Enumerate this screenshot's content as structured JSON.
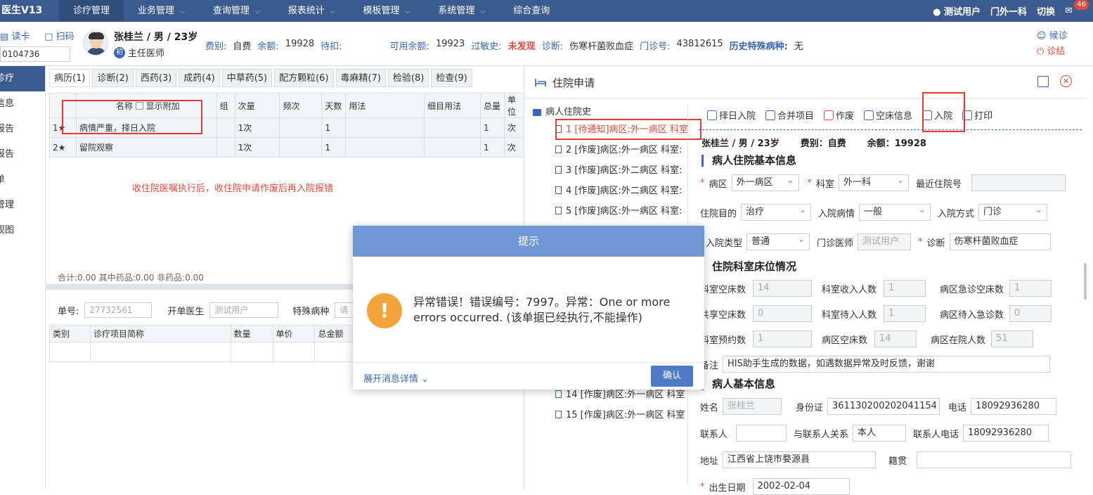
{
  "app": {
    "brand": "医生V13"
  },
  "nav": [
    {
      "label": "诊疗管理",
      "active": true,
      "chev": false
    },
    {
      "label": "业务管理",
      "chev": true
    },
    {
      "label": "查询管理",
      "chev": true
    },
    {
      "label": "报表统计",
      "chev": true
    },
    {
      "label": "模板管理",
      "chev": true
    },
    {
      "label": "系统管理",
      "chev": true
    },
    {
      "label": "综合查询",
      "chev": false
    }
  ],
  "top_right": {
    "user": "测试用户",
    "dept": "门外一科",
    "switch": "切换",
    "mail_count": "46"
  },
  "patient": {
    "read_card": "读卡",
    "scan": "扫码",
    "id_value": "0104736",
    "name": "张桂兰 / 男 / 23岁",
    "chip": "初",
    "doctor_title": "主任医师",
    "fee_type_label": "费别:",
    "fee_type": "自费",
    "balance_label": "余额:",
    "balance": "19928",
    "pending_label": "待扣:",
    "available_label": "可用余额:",
    "available": "19923",
    "allergy_label": "过敏史:",
    "allergy": "未发现",
    "diagnosis_label": "诊断:",
    "diagnosis": "伤寒杆菌败血症",
    "clinic_no_label": "门诊号:",
    "clinic_no": "43812615",
    "special_label": "历史特殊病种:",
    "special": "无",
    "wait_btn": "候诊",
    "finish_btn": "诊结"
  },
  "sidebar": [
    "诊疗",
    "信息",
    "报告",
    "报告",
    "单",
    "管理",
    "视图"
  ],
  "tabs": [
    "病历(1)",
    "诊断(2)",
    "西药(3)",
    "成药(4)",
    "中草药(5)",
    "配方颗粒(6)",
    "毒麻精(7)",
    "检验(8)",
    "检查(9)"
  ],
  "order_table": {
    "headers": [
      "",
      "名称",
      "显示附加",
      "组",
      "次量",
      "频次",
      "天数",
      "用法",
      "细目用法",
      "总量",
      "单位"
    ],
    "rows": [
      {
        "no": "1★",
        "name": "病情严重，择日入院",
        "dose": "1次",
        "days": "1",
        "total": "1",
        "unit": "次"
      },
      {
        "no": "2★",
        "name": "留院观察",
        "dose": "1次",
        "days": "1",
        "total": "1",
        "unit": "次"
      }
    ]
  },
  "note": "收住院医嘱执行后，收住院申请作废后再入院报错",
  "summary": "合计:0.00   其中药品:0.00   非药品:0.00",
  "bill": {
    "no_label": "单号:",
    "no": "27732561",
    "doctor_label": "开单医生",
    "doctor": "测试用户",
    "disease_label": "特殊病种",
    "disease_placeholder": "请"
  },
  "item_table": {
    "headers": [
      "类别",
      "诊疗项目简称",
      "数量",
      "单价",
      "总金额"
    ]
  },
  "right": {
    "title": "住院申请",
    "tree_root": "病人住院史",
    "tree": [
      "1 [待通知]病区:外一病区 科室",
      "2 [作废]病区:外一病区 科室:",
      "3 [作废]病区:外二病区 科室:",
      "4 [作废]病区:外二病区 科室:",
      "5 [作废]病区:外一病区 科室:",
      "14 [作废]病区:外一病区 科室",
      "15 [作废]病区:外一病区 科室"
    ],
    "toolbar": [
      "择日入院",
      "合并项目",
      "作废",
      "空床信息",
      "入院",
      "打印"
    ],
    "pinfo": {
      "name": "张桂兰 / 男 / 23岁",
      "fee": "费别：自费",
      "balance": "余额：19928"
    },
    "sec1": "病人住院基本信息",
    "ward_label": "病区",
    "ward": "外一病区",
    "dept_label": "科室",
    "dept": "外一科",
    "recent_label": "最近住院号",
    "purpose_label": "住院目的",
    "purpose": "治疗",
    "cond_label": "入院病情",
    "cond": "一般",
    "mode_label": "入院方式",
    "mode": "门诊",
    "type_label": "入院类型",
    "type": "普通",
    "doc_label": "门诊医师",
    "doc": "测试用户",
    "diag_label": "诊断",
    "diag": "伤寒杆菌败血症",
    "sec2": "住院科室床位情况",
    "beds": [
      {
        "l1": "科室空床数",
        "v1": "14",
        "l2": "科室收入人数",
        "v2": "1",
        "l3": "病区急诊空床数",
        "v3": "1"
      },
      {
        "l1": "共享空床数",
        "v1": "0",
        "l2": "科室待入人数",
        "v2": "1",
        "l3": "病区待入急诊数",
        "v3": "0"
      },
      {
        "l1": "科室预约数",
        "v1": "1",
        "l2": "病区空床数",
        "v2": "14",
        "l3": "病区在院人数",
        "v3": "51"
      }
    ],
    "remark_label": "备注",
    "remark": "HIS助手生成的数据，如遇数据异常及时反馈，谢谢",
    "sec3": "病人基本信息",
    "pname_label": "姓名",
    "pname": "张桂兰",
    "idcard_label": "身份证",
    "idcard": "361130200202041154",
    "phone_label": "电话",
    "phone": "18092936280",
    "contact_label": "联系人",
    "relation_label": "与联系人关系",
    "relation": "本人",
    "cphone_label": "联系人电话",
    "cphone": "18092936280",
    "addr_label": "地址",
    "addr": "江西省上饶市婺源县",
    "origin_label": "籍贯",
    "birth_label": "出生日期",
    "birth": "2002-02-04"
  },
  "modal": {
    "title": "提示",
    "message": "异常错误！错误编号：7997。异常：One or more errors occurred. (该单据已经执行,不能操作)",
    "icon": "!",
    "details": "展开消息详情",
    "ok": "确认"
  }
}
